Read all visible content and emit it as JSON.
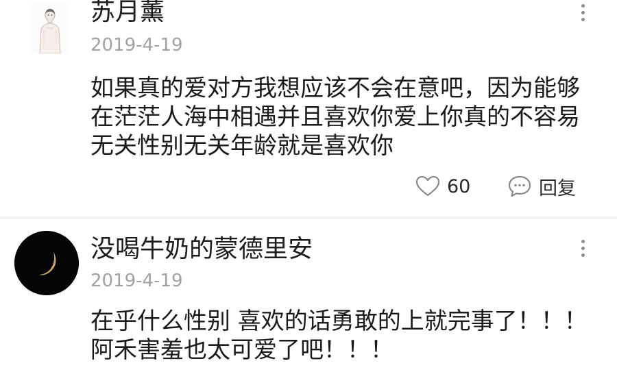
{
  "comments": [
    {
      "username": "苏月薰",
      "date": "2019-4-19",
      "lines": [
        "如果真的爱对方我想应该不会在意吧，因为能够",
        "在茫茫人海中相遇并且喜欢你爱上你真的不容易",
        "无关性别无关年龄就是喜欢你"
      ],
      "likes": "60",
      "reply_label": "回复",
      "avatar_icon": "person-sketch-avatar",
      "menu_icon": "more-vertical-icon"
    },
    {
      "username": "没喝牛奶的蒙德里安",
      "date": "2019-4-19",
      "lines": [
        "在乎什么性别 喜欢的话勇敢的上就完事了！！！",
        "阿禾害羞也太可爱了吧！！！"
      ],
      "avatar_icon": "crescent-moon-avatar",
      "menu_icon": "more-vertical-icon"
    }
  ],
  "colors": {
    "text": "#1a1a1a",
    "date": "#a2a2a2",
    "icon": "#8a8a8a",
    "divider": "#f0f0f0"
  }
}
